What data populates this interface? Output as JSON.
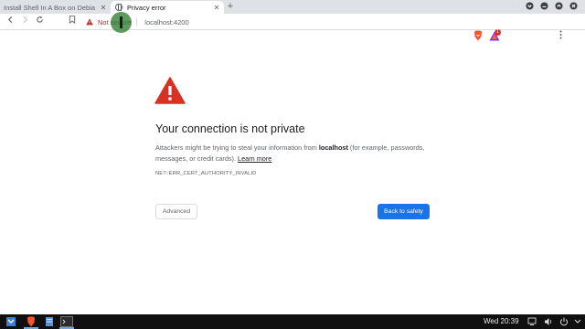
{
  "browser": {
    "tabs": [
      {
        "title": "Install Shell In A Box on Debia",
        "active": false
      },
      {
        "title": "Privacy error",
        "active": true
      }
    ],
    "new_tab_label": "+",
    "close_glyph": "✕",
    "omnibox": {
      "security_label": "Not secure",
      "url": "localhost:4200"
    },
    "extension_badge_count": "1"
  },
  "page": {
    "title": "Your connection is not private",
    "description_before": "Attackers might be trying to steal your information from ",
    "host": "localhost",
    "description_after": " (for example, passwords, messages, or credit cards). ",
    "learn_more": "Learn more",
    "error_code": "NET::ERR_CERT_AUTHORITY_INVALID",
    "advanced_button": "Advanced",
    "safety_button": "Back to safety"
  },
  "taskbar": {
    "clock": "Wed 20:39"
  },
  "colors": {
    "danger": "#d93025",
    "primary": "#1a73e8",
    "taskbar": "#101010",
    "tab_strip": "#dee1e6"
  },
  "icons": [
    "globe-icon",
    "warning-icon",
    "brave-lion-icon",
    "reload-icon",
    "bookmark-icon",
    "kebab-menu-icon",
    "terminal-icon",
    "volume-icon",
    "power-icon"
  ]
}
